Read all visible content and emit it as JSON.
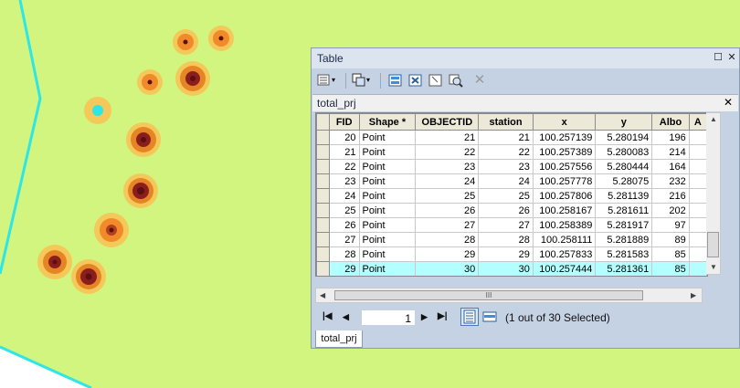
{
  "window": {
    "title": "Table"
  },
  "tab": {
    "name": "total_prj"
  },
  "bottom_tab": {
    "label": "total_prj"
  },
  "table": {
    "columns": [
      "FID",
      "Shape *",
      "OBJECTID",
      "station",
      "x",
      "y",
      "Albo",
      "A"
    ],
    "rows": [
      {
        "FID": "20",
        "Shape": "Point",
        "OBJECTID": "21",
        "station": "21",
        "x": "100.257139",
        "y": "5.280194",
        "Albo": "196"
      },
      {
        "FID": "21",
        "Shape": "Point",
        "OBJECTID": "22",
        "station": "22",
        "x": "100.257389",
        "y": "5.280083",
        "Albo": "214"
      },
      {
        "FID": "22",
        "Shape": "Point",
        "OBJECTID": "23",
        "station": "23",
        "x": "100.257556",
        "y": "5.280444",
        "Albo": "164"
      },
      {
        "FID": "23",
        "Shape": "Point",
        "OBJECTID": "24",
        "station": "24",
        "x": "100.257778",
        "y": "5.28075",
        "Albo": "232"
      },
      {
        "FID": "24",
        "Shape": "Point",
        "OBJECTID": "25",
        "station": "25",
        "x": "100.257806",
        "y": "5.281139",
        "Albo": "216"
      },
      {
        "FID": "25",
        "Shape": "Point",
        "OBJECTID": "26",
        "station": "26",
        "x": "100.258167",
        "y": "5.281611",
        "Albo": "202"
      },
      {
        "FID": "26",
        "Shape": "Point",
        "OBJECTID": "27",
        "station": "27",
        "x": "100.258389",
        "y": "5.281917",
        "Albo": "97"
      },
      {
        "FID": "27",
        "Shape": "Point",
        "OBJECTID": "28",
        "station": "28",
        "x": "100.258111",
        "y": "5.281889",
        "Albo": "89"
      },
      {
        "FID": "28",
        "Shape": "Point",
        "OBJECTID": "29",
        "station": "29",
        "x": "100.257833",
        "y": "5.281583",
        "Albo": "85"
      },
      {
        "FID": "29",
        "Shape": "Point",
        "OBJECTID": "30",
        "station": "30",
        "x": "100.257444",
        "y": "5.281361",
        "Albo": "85",
        "selected": true
      }
    ]
  },
  "scrollbar": {
    "grip": "III"
  },
  "nav": {
    "current_record": "1",
    "selection_status": "(1 out of 30 Selected)"
  },
  "colors": {
    "map_background": "#d1f57e",
    "boundary_line": "#2ee6e6",
    "selected_row": "#b3ffff",
    "window_frame": "#c5d2e3"
  }
}
